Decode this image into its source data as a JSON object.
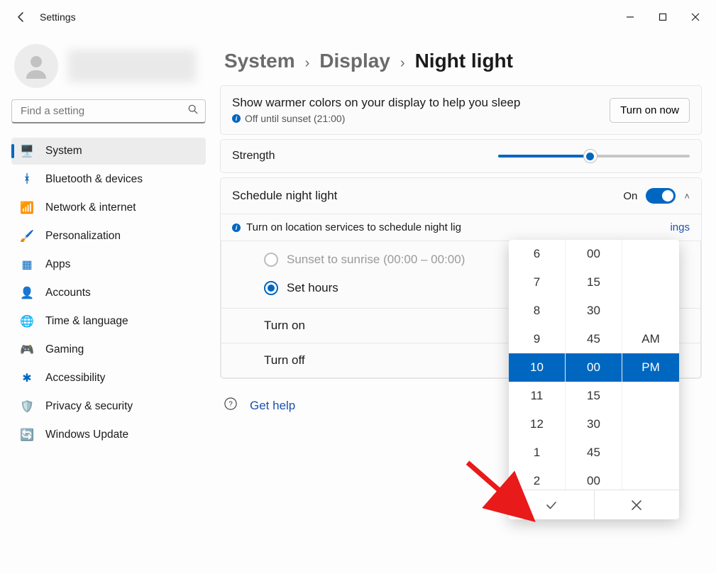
{
  "app_title": "Settings",
  "search": {
    "placeholder": "Find a setting"
  },
  "nav": {
    "items": [
      {
        "icon": "🖥️",
        "label": "System"
      },
      {
        "icon": "ᚼ",
        "label": "Bluetooth & devices"
      },
      {
        "icon": "📶",
        "label": "Network & internet"
      },
      {
        "icon": "🖌️",
        "label": "Personalization"
      },
      {
        "icon": "▦",
        "label": "Apps"
      },
      {
        "icon": "👤",
        "label": "Accounts"
      },
      {
        "icon": "🌐",
        "label": "Time & language"
      },
      {
        "icon": "🎮",
        "label": "Gaming"
      },
      {
        "icon": "✱",
        "label": "Accessibility"
      },
      {
        "icon": "🛡️",
        "label": "Privacy & security"
      },
      {
        "icon": "🔄",
        "label": "Windows Update"
      }
    ]
  },
  "breadcrumb": {
    "parent1": "System",
    "parent2": "Display",
    "current": "Night light"
  },
  "description": {
    "title": "Show warmer colors on your display to help you sleep",
    "status": "Off until sunset (21:00)",
    "action": "Turn on now"
  },
  "strength_label": "Strength",
  "strength_value_pct": 48,
  "schedule": {
    "header": "Schedule night light",
    "state_label": "On",
    "info": "Turn on location services to schedule night lig",
    "info_link": "ings",
    "opt_sunset": "Sunset to sunrise (00:00 – 00:00)",
    "opt_set_hours": "Set hours",
    "turn_on_label": "Turn on",
    "turn_off_label": "Turn off"
  },
  "help": {
    "label": "Get help"
  },
  "picker": {
    "hours": [
      "6",
      "7",
      "8",
      "9",
      "10",
      "11",
      "12",
      "1",
      "2"
    ],
    "minutes": [
      "00",
      "15",
      "30",
      "45",
      "00",
      "15",
      "30",
      "45",
      "00"
    ],
    "ampm": [
      "",
      "",
      "",
      "AM",
      "PM",
      "",
      "",
      "",
      ""
    ],
    "selected_index": 4,
    "accept_glyph": "✓",
    "cancel_glyph": "✕"
  }
}
